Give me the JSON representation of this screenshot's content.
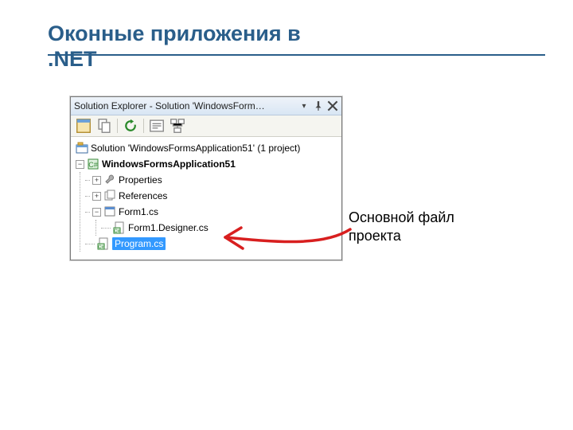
{
  "slide": {
    "title_line1": "Оконные приложения в",
    "title_line2": ".NET"
  },
  "panel": {
    "title": "Solution Explorer - Solution 'WindowsForm…"
  },
  "tree": {
    "solution_label": "Solution 'WindowsFormsApplication51' (1 project)",
    "project_label": "WindowsFormsApplication51",
    "properties_label": "Properties",
    "references_label": "References",
    "form1_label": "Form1.cs",
    "form1_designer_label": "Form1.Designer.cs",
    "program_label": "Program.cs"
  },
  "annotation": {
    "text_line1": "Основной файл",
    "text_line2": "проекта"
  }
}
